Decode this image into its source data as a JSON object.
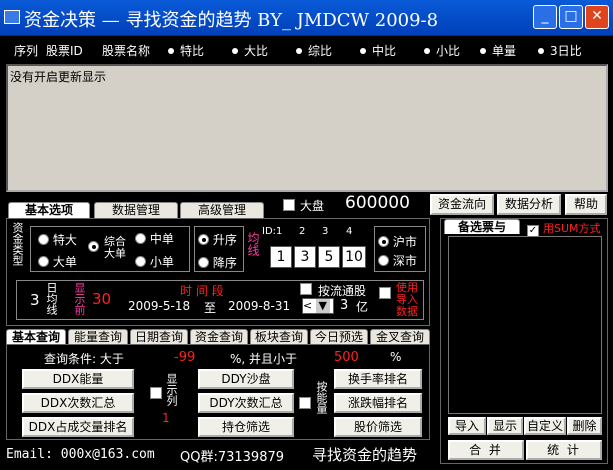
{
  "window": {
    "title": "资金决策  —  寻找资金的趋势  BY_ JMDCW 2009-8",
    "minimize": "_",
    "maximize": "□",
    "close": "✕"
  },
  "columns": [
    "序列",
    "股票ID",
    "股票名称",
    "特比",
    "大比",
    "综比",
    "中比",
    "小比",
    "单量",
    "3日比"
  ],
  "list": {
    "empty_text": "没有开启更新显示"
  },
  "main_tabs": [
    "基本选项",
    "数据管理",
    "高级管理"
  ],
  "dapan": {
    "label": "大盘",
    "value": "600000"
  },
  "top_buttons": [
    "资金流向",
    "数据分析",
    "帮助"
  ],
  "fund_type": {
    "label": "资金类型",
    "options": [
      "特大",
      "综合大单",
      "中单",
      "大单",
      "小单"
    ]
  },
  "sort": {
    "options": [
      "升序",
      "降序"
    ],
    "label": "均线"
  },
  "id_labels": [
    "ID:1",
    "2",
    "3",
    "4"
  ],
  "id_values": [
    "1",
    "3",
    "5",
    "10"
  ],
  "market": {
    "options": [
      "沪市",
      "深市"
    ]
  },
  "period": {
    "days": "3",
    "days_label": "日均线",
    "show_label": "显示前",
    "show_value": "30",
    "time_label": "时 间 段",
    "start": "2009-5-18",
    "to": "至",
    "end": "2009-8-31",
    "circ_label": "按流通股",
    "circ_value": "3",
    "circ_unit": "亿",
    "import_label": "使用导入数据"
  },
  "watch": {
    "tab": "备选票与",
    "sum_label": "用SUM方式",
    "buttons": [
      "导入",
      "显示",
      "自定义",
      "删除"
    ],
    "merge": "合 并",
    "stats": "统 计"
  },
  "query_tabs": [
    "基本查询",
    "能量查询",
    "日期查询",
    "资金查询",
    "板块查询",
    "今日预选",
    "金叉查询"
  ],
  "query": {
    "cond_label": "查询条件: 大于",
    "min": "-99",
    "pct_and": "%, 并且小于",
    "max": "500",
    "pct": "%",
    "show_col": "显示列",
    "show_col_val": "1",
    "by_energy": "按能量",
    "buttons_left": [
      "DDX能量",
      "DDX次数汇总",
      "DDX占成交量排名"
    ],
    "buttons_mid": [
      "DDY沙盘",
      "DDY次数汇总",
      "持仓筛选"
    ],
    "buttons_right": [
      "换手率排名",
      "涨跌幅排名",
      "股价筛选"
    ]
  },
  "status": {
    "email": "Email: 000x@163.com",
    "qq": "QQ群:73139879",
    "slogan": "寻找资金的趋势"
  },
  "colors": {
    "title_bar": "#0a5ad8",
    "accent_red": "#ff2020",
    "accent_pink": "#ff3ca0",
    "panel": "#d4d0c8"
  }
}
